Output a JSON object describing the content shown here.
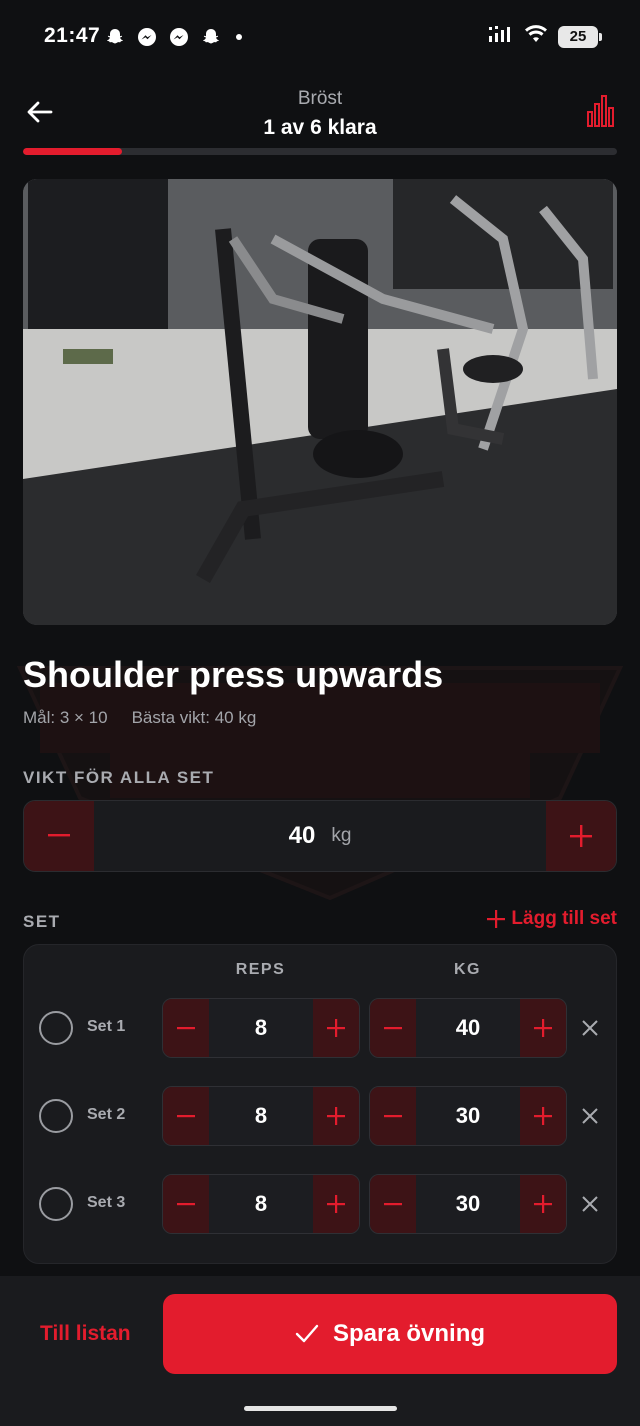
{
  "status_bar": {
    "time": "21:47",
    "icons": [
      "snapchat-icon",
      "messenger-icon",
      "messenger-icon",
      "snapchat-icon"
    ],
    "battery": "25"
  },
  "header": {
    "category": "Bröst",
    "progress_text": "1 av 6 klara",
    "progress_fraction": 0.1667
  },
  "exercise": {
    "title": "Shoulder press upwards",
    "goal": "Mål: 3 × 10",
    "best_weight": "Bästa vikt: 40 kg"
  },
  "weight_all": {
    "label": "VIKT FÖR ALLA SET",
    "value": "40",
    "unit": "kg"
  },
  "sets": {
    "label": "SET",
    "add_label": "Lägg till set",
    "col_reps": "REPS",
    "col_kg": "KG",
    "rows": [
      {
        "name": "Set 1",
        "reps": "8",
        "kg": "40"
      },
      {
        "name": "Set 2",
        "reps": "8",
        "kg": "30"
      },
      {
        "name": "Set 3",
        "reps": "8",
        "kg": "30"
      }
    ]
  },
  "bottom": {
    "to_list": "Till listan",
    "save": "Spara övning"
  },
  "colors": {
    "accent": "#e31c2d",
    "background": "#0f1012",
    "card": "#1a1b1e",
    "stepper_button": "#3d1316"
  }
}
